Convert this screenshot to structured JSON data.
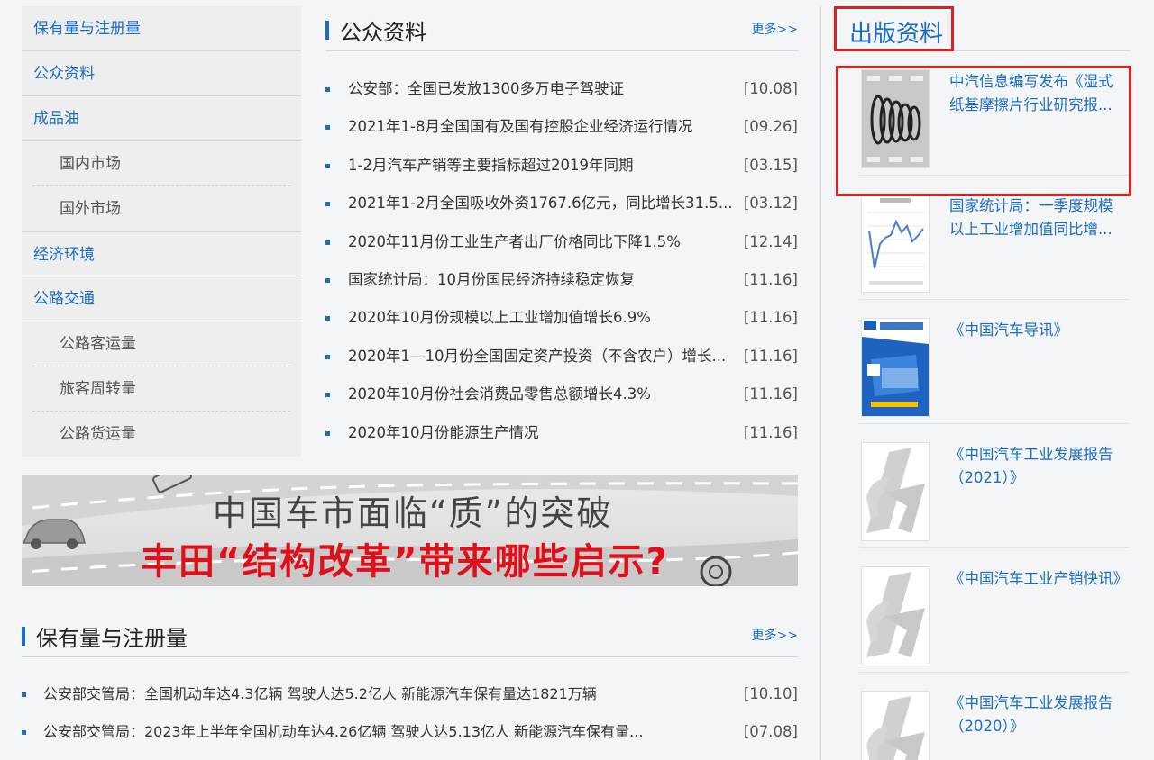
{
  "sidebar": {
    "items": [
      {
        "label": "保有量与注册量",
        "type": "main"
      },
      {
        "label": "公众资料",
        "type": "main"
      },
      {
        "label": "成品油",
        "type": "main"
      },
      {
        "label": "国内市场",
        "type": "sub"
      },
      {
        "label": "国外市场",
        "type": "sub"
      },
      {
        "label": "经济环境",
        "type": "main"
      },
      {
        "label": "公路交通",
        "type": "main"
      },
      {
        "label": "公路客运量",
        "type": "sub"
      },
      {
        "label": "旅客周转量",
        "type": "sub"
      },
      {
        "label": "公路货运量",
        "type": "sub"
      }
    ]
  },
  "news": {
    "title": "公众资料",
    "more": "更多>>",
    "items": [
      {
        "text": "公安部：全国已发放1300多万电子驾驶证",
        "date": "[10.08]"
      },
      {
        "text": "2021年1-8月全国国有及国有控股企业经济运行情况",
        "date": "[09.26]"
      },
      {
        "text": "1-2月汽车产销等主要指标超过2019年同期",
        "date": "[03.15]"
      },
      {
        "text": "2021年1-2月全国吸收外资1767.6亿元，同比增长31.5...",
        "date": "[03.12]"
      },
      {
        "text": "2020年11月份工业生产者出厂价格同比下降1.5%",
        "date": "[12.14]"
      },
      {
        "text": "国家统计局：10月份国民经济持续稳定恢复",
        "date": "[11.16]"
      },
      {
        "text": "2020年10月份规模以上工业增加值增长6.9%",
        "date": "[11.16]"
      },
      {
        "text": "2020年1—10月份全国固定资产投资（不含农户）增长...",
        "date": "[11.16]"
      },
      {
        "text": "2020年10月份社会消费品零售总额增长4.3%",
        "date": "[11.16]"
      },
      {
        "text": "2020年10月份能源生产情况",
        "date": "[11.16]"
      }
    ]
  },
  "banner": {
    "line1": "中国车市面临“质”的突破",
    "line2": "丰田“结构改革”带来哪些启示?"
  },
  "bottom": {
    "title": "保有量与注册量",
    "more": "更多>>",
    "items": [
      {
        "text": "公安部交管局：全国机动车达4.3亿辆 驾驶人达5.2亿人 新能源汽车保有量达1821万辆",
        "date": "[10.10]"
      },
      {
        "text": "公安部交管局：2023年上半年全国机动车达4.26亿辆 驾驶人达5.13亿人 新能源汽车保有量...",
        "date": "[07.08]"
      }
    ]
  },
  "publications": {
    "title": "出版资料",
    "items": [
      {
        "text": "中汽信息编写发布《湿式纸基摩擦片行业研究报...",
        "thumb": "friction-plate-image"
      },
      {
        "text": "国家统计局：一季度规模以上工业增加值同比增...",
        "thumb": "line-chart-image"
      },
      {
        "text": "《中国汽车导讯》",
        "thumb": "magazine-cover-image"
      },
      {
        "text": "《中国汽车工业发展报告（2021）》",
        "thumb": "cm-logo-image"
      },
      {
        "text": "《中国汽车工业产销快讯》",
        "thumb": "cm-logo-image"
      },
      {
        "text": "《中国汽车工业发展报告（2020）》",
        "thumb": "cm-logo-image"
      }
    ]
  },
  "colors": {
    "accent": "#1a6dc7",
    "highlight": "#e02020",
    "banner_red": "#e0101a"
  }
}
